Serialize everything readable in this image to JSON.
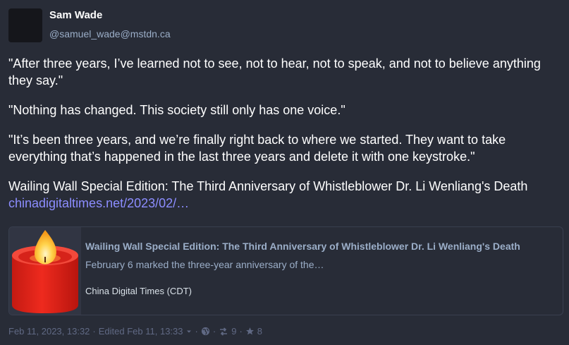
{
  "author": {
    "display_name": "Sam Wade",
    "handle": "@samuel_wade@mstdn.ca"
  },
  "post": {
    "paragraphs": [
      "\"After three years, I’ve learned not to see, not to hear, not to speak, and not to believe anything they say.\"",
      "\"Nothing has changed. This society still only has one voice.\"",
      "\"It’s been three years, and we’re finally right back to where we started. They want to take everything that’s happened in the last three years and delete it with one keystroke.\""
    ],
    "headline": "Wailing Wall Special Edition: The Third Anniversary of Whistleblower Dr. Li Wenliang's Death",
    "link_text": "chinadigitaltimes.net/2023/02/…"
  },
  "card": {
    "title": "Wailing Wall Special Edition: The Third Anniversary of Whistleblower Dr. Li Wenliang's Death",
    "description": "February 6 marked the three-year anniversary of the…",
    "provider": "China Digital Times (CDT)",
    "image_icon": "candle-icon"
  },
  "footer": {
    "timestamp": "Feb 11, 2023, 13:32",
    "edited": "Edited Feb 11, 13:33",
    "boosts": "9",
    "favourites": "8",
    "icons": [
      "chevron-down-icon",
      "globe-icon",
      "retweet-icon",
      "star-icon"
    ]
  },
  "colors": {
    "background": "#282c37",
    "link": "#8c8dff",
    "muted": "#606984",
    "secondary": "#9baec8",
    "candle_red": "#e8261c",
    "flame_yellow": "#ffd24a"
  }
}
